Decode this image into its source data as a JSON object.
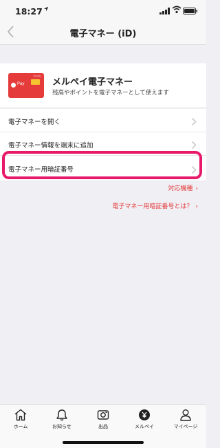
{
  "status_bar": {
    "time": "18:27",
    "location_arrow": "location-arrow-icon"
  },
  "nav": {
    "title": "電子マネー (iD)",
    "back_icon": "chevron-left-icon"
  },
  "card": {
    "brand_text": "merpay",
    "pay_text": "Pay",
    "title": "メルペイ電子マネー",
    "description": "残高やポイントを電子マネーとして使えます"
  },
  "menu": {
    "items": [
      {
        "label": "電子マネーを開く"
      },
      {
        "label": "電子マネー情報を端末に追加"
      },
      {
        "label": "電子マネー用暗証番号"
      }
    ]
  },
  "links": {
    "supported_devices": "対応機種",
    "pin_about": "電子マネー用暗証番号とは？",
    "arrow": "›"
  },
  "tabbar": {
    "items": [
      {
        "label": "ホーム",
        "icon": "home-icon"
      },
      {
        "label": "お知らせ",
        "icon": "bell-icon"
      },
      {
        "label": "出品",
        "icon": "camera-icon"
      },
      {
        "label": "メルペイ",
        "icon": "yen-icon"
      },
      {
        "label": "マイページ",
        "icon": "person-icon"
      }
    ]
  },
  "colors": {
    "accent": "#e53b3b",
    "highlight": "#e8196a",
    "background": "#efeff4"
  }
}
